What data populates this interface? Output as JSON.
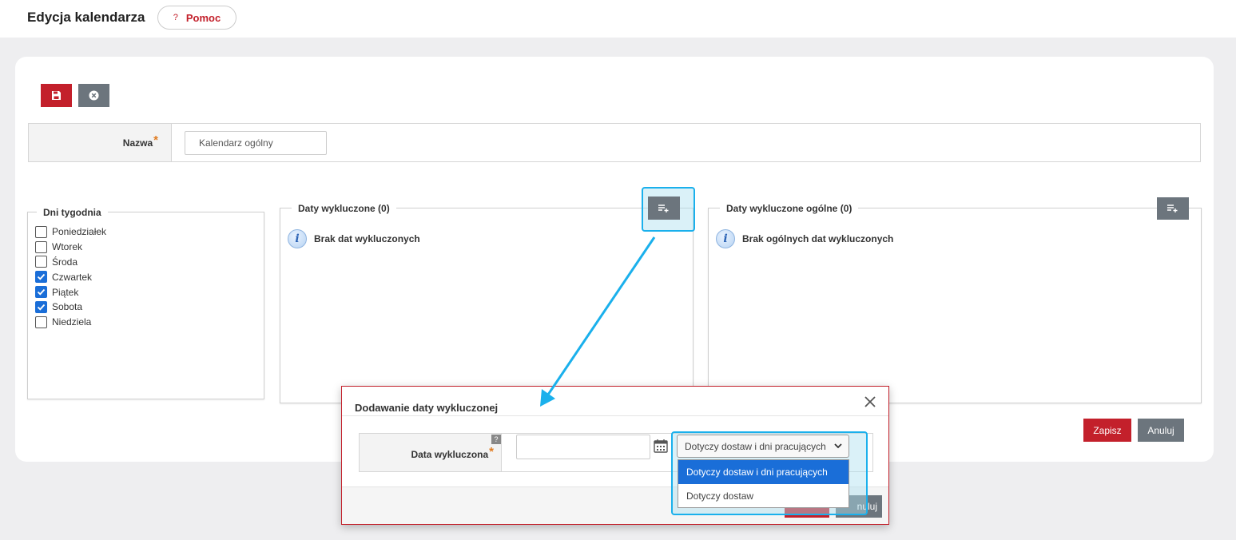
{
  "header": {
    "title": "Edycja kalendarza",
    "help_label": "Pomoc",
    "help_icon": "?"
  },
  "toolbar": {
    "save_icon": "floppy-disk-icon",
    "cancel_icon": "close-circle-icon"
  },
  "form": {
    "name_label": "Nazwa",
    "required_mark": "*",
    "name_value": "Kalendarz ogólny"
  },
  "days": {
    "legend": "Dni tygodnia",
    "items": [
      {
        "label": "Poniedziałek",
        "checked": false
      },
      {
        "label": "Wtorek",
        "checked": false
      },
      {
        "label": "Środa",
        "checked": false
      },
      {
        "label": "Czwartek",
        "checked": true
      },
      {
        "label": "Piątek",
        "checked": true
      },
      {
        "label": "Sobota",
        "checked": true
      },
      {
        "label": "Niedziela",
        "checked": false
      }
    ]
  },
  "excluded": {
    "legend": "Daty wykluczone (0)",
    "empty_text": "Brak dat wykluczonych"
  },
  "excluded_general": {
    "legend": "Daty wykluczone ogólne (0)",
    "empty_text": "Brak ogólnych dat wykluczonych"
  },
  "actions": {
    "save_label": "Zapisz",
    "cancel_label": "Anuluj"
  },
  "modal": {
    "title": "Dodawanie daty wykluczonej",
    "date_label": "Data wykluczona",
    "help_mark": "?",
    "date_value": "",
    "select_value": "Dotyczy dostaw i dni pracujących",
    "options": [
      {
        "label": "Dotyczy dostaw i dni pracujących",
        "selected": true
      },
      {
        "label": "Dotyczy dostaw",
        "selected": false
      }
    ],
    "footer_cancel_label": "nuluj"
  },
  "colors": {
    "accent_red": "#c3202b",
    "gray_button": "#6c757d",
    "highlight": "#1ab0ec",
    "selected_blue": "#1a6ed8"
  }
}
